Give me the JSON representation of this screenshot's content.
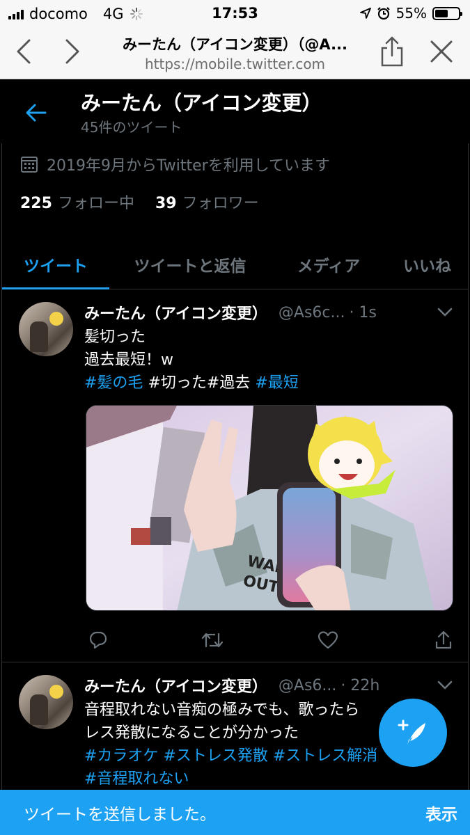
{
  "status_bar": {
    "carrier": "docomo",
    "network": "4G",
    "time": "17:53",
    "battery": "55%",
    "battery_level": 0.55
  },
  "browser": {
    "title": "みーたん（アイコン変更）（@A...",
    "url": "https://mobile.twitter.com"
  },
  "header": {
    "name": "みーたん（アイコン変更）",
    "tweet_count": "45件のツイート"
  },
  "profile": {
    "joined": "2019年9月からTwitterを利用しています",
    "following_count": "225",
    "following_label": "フォロー中",
    "followers_count": "39",
    "followers_label": "フォロワー"
  },
  "tabs": [
    {
      "label": "ツイート",
      "active": true
    },
    {
      "label": "ツイートと返信",
      "active": false
    },
    {
      "label": "メディア",
      "active": false
    },
    {
      "label": "いいね",
      "active": false
    }
  ],
  "tweets": [
    {
      "name": "みーたん（アイコン変更）",
      "handle": "@As6c...",
      "time": "· 1s",
      "line1": "髪切った",
      "line2": "過去最短！w",
      "tags": [
        "#髪の毛",
        "#切った#過去",
        "#最短"
      ]
    },
    {
      "name": "みーたん（アイコン変更）",
      "handle": "@As6...",
      "time": "· 22h",
      "line1": "音程取れない音痴の極みでも、歌ったら",
      "line2": "レス発散になることが分かった",
      "tags": [
        "#カラオケ",
        "#ストレス発散",
        "#ストレス解消",
        "#音程取れない"
      ]
    }
  ],
  "toast": {
    "message": "ツイートを送信しました。",
    "action": "表示"
  },
  "colors": {
    "accent": "#1da1f2",
    "background": "#000000",
    "muted": "#6e767d",
    "border": "#2f3336"
  }
}
